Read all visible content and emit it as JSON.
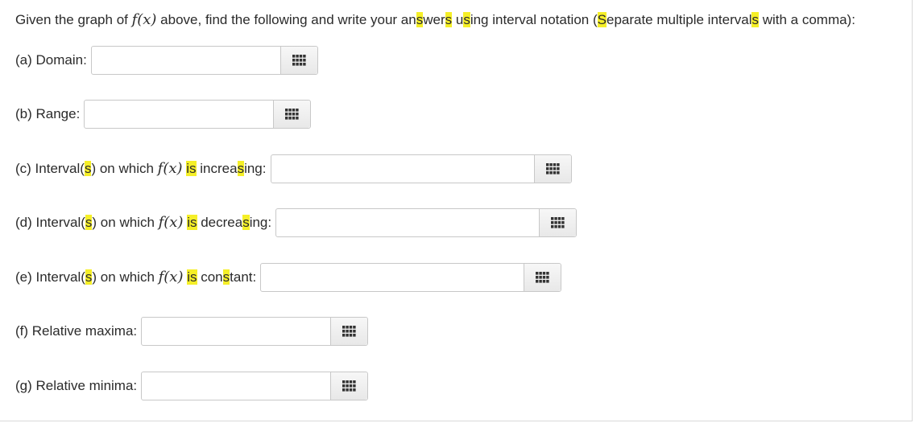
{
  "instructions": {
    "p1": "Given the graph of ",
    "func": "f(x)",
    "p2": " above, find the following and write your an",
    "h1": "s",
    "p3": "wer",
    "h2": "s",
    "p4": " u",
    "h3": "s",
    "p5": "ing interval notation (",
    "h4": "S",
    "p6": "eparate multiple interval",
    "h5": "s",
    "p7": " with a comma):"
  },
  "questions": {
    "a": {
      "label": "(a) Domain:",
      "value": ""
    },
    "b": {
      "label": "(b) Range:",
      "value": ""
    },
    "c": {
      "pre": "(c) Interval(",
      "h1": "s",
      "mid1": ") on which ",
      "func": "f(x)",
      "sp": " ",
      "h2": "is",
      "mid2": " increa",
      "h3": "s",
      "post": "ing:",
      "value": ""
    },
    "d": {
      "pre": "(d) Interval(",
      "h1": "s",
      "mid1": ") on which ",
      "func": "f(x)",
      "sp": " ",
      "h2": "is",
      "mid2": " decrea",
      "h3": "s",
      "post": "ing:",
      "value": ""
    },
    "e": {
      "pre": "(e) Interval(",
      "h1": "s",
      "mid1": ") on which ",
      "func": "f(x)",
      "sp": " ",
      "h2": "is",
      "mid2": " con",
      "h3": "s",
      "post": "tant:",
      "value": ""
    },
    "f": {
      "label": "(f) Relative maxima:",
      "value": ""
    },
    "g": {
      "label": "(g) Relative minima:",
      "value": ""
    }
  },
  "colors": {
    "highlight": "#f5ef28",
    "text": "#2b2b2b",
    "input_border": "#c8c8c8",
    "icon": "#333333"
  },
  "icons": {
    "keypad": "grid-keypad-icon"
  }
}
